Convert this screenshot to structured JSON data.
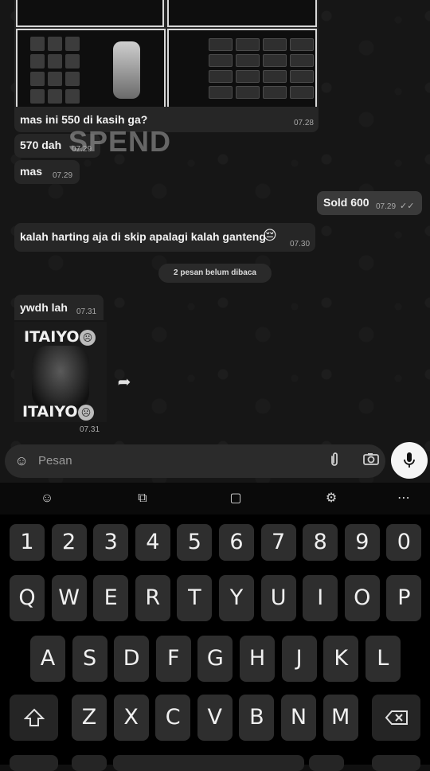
{
  "chat": {
    "messages": [
      {
        "text": "mas ini 550 di kasih ga?",
        "time": "07.28"
      },
      {
        "text": "570 dah",
        "time": "07.29"
      },
      {
        "text": "mas",
        "time": "07.29"
      },
      {
        "text": "Sold 600",
        "time": "07.29",
        "checks": "✓✓"
      },
      {
        "text": "kalah harting aja di skip apalagi kalah ganteng",
        "emoji": "😔",
        "time": "07.30"
      },
      {
        "text": "ywdh lah",
        "time": "07.31"
      }
    ],
    "watermark": "SPEND",
    "unread_label": "2 pesan belum dibaca",
    "sticker": {
      "top_text": "ITAIYO",
      "bottom_text": "ITAIYO",
      "time": "07.31"
    }
  },
  "composer": {
    "placeholder": "Pesan",
    "icons": [
      "sticker-icon",
      "attach-icon",
      "camera-icon",
      "mic-icon"
    ]
  },
  "keyboard": {
    "toolbar_icons": [
      "emoji-icon",
      "clipboard-tool-icon",
      "clipboard-icon",
      "settings-icon",
      "more-icon"
    ],
    "rows": [
      [
        "1",
        "2",
        "3",
        "4",
        "5",
        "6",
        "7",
        "8",
        "9",
        "0"
      ],
      [
        "Q",
        "W",
        "E",
        "R",
        "T",
        "Y",
        "U",
        "I",
        "O",
        "P"
      ],
      [
        "A",
        "S",
        "D",
        "F",
        "G",
        "H",
        "J",
        "K",
        "L"
      ],
      [
        "Z",
        "X",
        "C",
        "V",
        "B",
        "N",
        "M"
      ]
    ]
  }
}
